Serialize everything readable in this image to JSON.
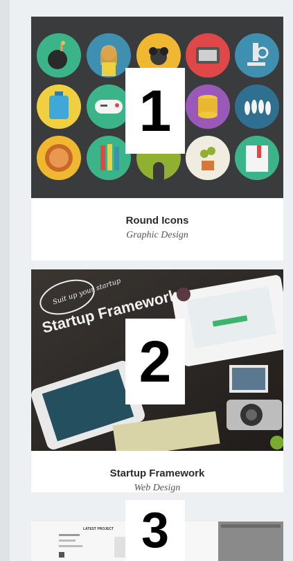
{
  "items": [
    {
      "number": "1",
      "title": "Round Icons",
      "category": "Graphic Design"
    },
    {
      "number": "2",
      "title": "Startup Framework",
      "category": "Web Design",
      "image_text": {
        "headline": "Startup Framework",
        "tagline": "Suit up your startup"
      }
    },
    {
      "number": "3",
      "image_text": {
        "heading": "LATEST PROJECT"
      }
    }
  ],
  "colors": {
    "page_bg": "#edf0f2",
    "card_bg": "#ffffff",
    "title": "#2b2b2b",
    "subtitle": "#555555"
  },
  "icons": [
    "bomb-icon",
    "woman-icon",
    "binoculars-icon",
    "tablet-pen-icon",
    "microscope-icon",
    "suitcase-icon",
    "gamepad-icon",
    "tie-icon",
    "coins-icon",
    "bowling-icon",
    "donut-icon",
    "pencils-icon",
    "mouse-icon",
    "plant-icon",
    "book-icon"
  ]
}
